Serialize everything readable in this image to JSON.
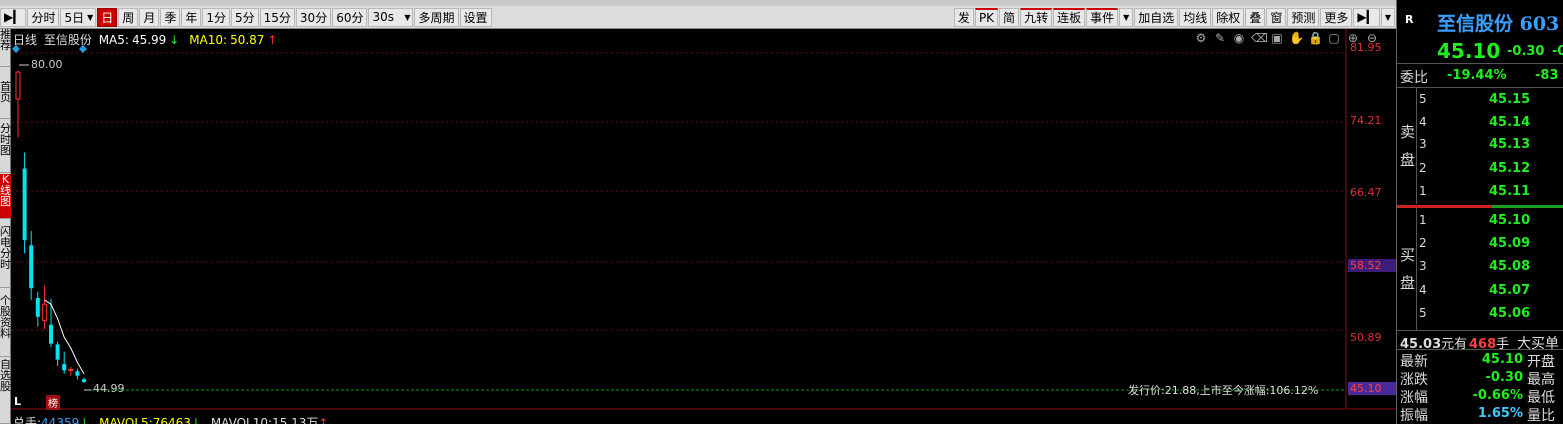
{
  "toolbar": {
    "items": [
      "分时",
      "5日",
      "日",
      "周",
      "月",
      "季",
      "年",
      "1分",
      "5分",
      "15分",
      "30分",
      "60分",
      "30s",
      "多周期",
      "设置"
    ],
    "active": "日",
    "right_items": [
      "发",
      "PK",
      "简",
      "九转",
      "连板",
      "事件",
      "加自选",
      "均线",
      "除权",
      "叠",
      "窗",
      "预测",
      "更多"
    ]
  },
  "left_tabs": [
    "推荐",
    "首页",
    "分时图",
    "K线图",
    "闪电分时",
    "个股资料",
    "自选股"
  ],
  "chart": {
    "period_label": "日线",
    "stock_name": "至信股份",
    "ma5_label": "MA5:",
    "ma5_value": "45.99",
    "ma10_label": "MA10:",
    "ma10_value": "50.87",
    "price_axis": [
      "81.95",
      "74.21",
      "66.47",
      "58.52",
      "50.89",
      "45.10"
    ],
    "high_annotation": "80.00",
    "low_annotation": "44.99",
    "issue_note": "发行价:21.88,上市至今涨幅:106.12%",
    "mark_l": "L",
    "mark_bang": "榜",
    "colors": {
      "up": "#ff3030",
      "down": "#00e5ee",
      "ma5": "#ffffff",
      "ma10": "#ffff00",
      "grid": "#6a0a0a"
    }
  },
  "chart_data": {
    "type": "candlestick",
    "title": "日线 至信股份",
    "ylim": [
      44.2,
      82.5
    ],
    "candles": [
      {
        "open": 76.8,
        "close": 79.8,
        "high": 80.0,
        "low": 72.5
      },
      {
        "open": 69.0,
        "close": 61.0,
        "high": 70.8,
        "low": 59.5
      },
      {
        "open": 60.4,
        "close": 55.6,
        "high": 62.0,
        "low": 54.3
      },
      {
        "open": 54.5,
        "close": 52.4,
        "high": 55.2,
        "low": 51.3
      },
      {
        "open": 52.0,
        "close": 53.8,
        "high": 55.9,
        "low": 51.0
      },
      {
        "open": 51.5,
        "close": 49.4,
        "high": 54.4,
        "low": 49.0
      },
      {
        "open": 49.3,
        "close": 47.6,
        "high": 49.6,
        "low": 46.9
      },
      {
        "open": 47.1,
        "close": 46.4,
        "high": 48.5,
        "low": 46.0
      },
      {
        "open": 46.4,
        "close": 46.5,
        "high": 46.8,
        "low": 45.8
      },
      {
        "open": 46.3,
        "close": 45.8,
        "high": 46.6,
        "low": 45.4
      },
      {
        "open": 45.4,
        "close": 45.1,
        "high": 45.6,
        "low": 44.99
      }
    ],
    "ma5": [
      null,
      null,
      null,
      null,
      54.3,
      53.8,
      52.2,
      50.1,
      48.9,
      47.3,
      46.0
    ]
  },
  "volume": {
    "total_label": "总手:",
    "total_value": "44359",
    "ma5_label": "MAVOL5:",
    "ma5_value": "76463",
    "ma10_label": "MAVOL10:",
    "ma10_value": "15.13万"
  },
  "quote": {
    "badge": "R",
    "name": "至信股份 603",
    "price": "45.10",
    "change": "-0.30",
    "pct": "-0",
    "weibi_label": "委比",
    "weibi": "-19.44%",
    "weicha": "-83",
    "sell_label_1": "卖",
    "sell_label_2": "盘",
    "buy_label_1": "买",
    "buy_label_2": "盘",
    "sell": [
      {
        "n": "5",
        "p": "45.15"
      },
      {
        "n": "4",
        "p": "45.14"
      },
      {
        "n": "3",
        "p": "45.13"
      },
      {
        "n": "2",
        "p": "45.12"
      },
      {
        "n": "1",
        "p": "45.11"
      }
    ],
    "buy": [
      {
        "n": "1",
        "p": "45.10"
      },
      {
        "n": "2",
        "p": "45.09"
      },
      {
        "n": "3",
        "p": "45.08"
      },
      {
        "n": "4",
        "p": "45.07"
      },
      {
        "n": "5",
        "p": "45.06"
      }
    ],
    "big_amount": "45.03",
    "big_unit": "元有",
    "big_vol": "468",
    "big_vol_unit": "手",
    "big_label": "大买单",
    "stats": [
      {
        "k": "最新",
        "v": "45.10",
        "k2": "开盘",
        "c": "#20ee20"
      },
      {
        "k": "涨跌",
        "v": "-0.30",
        "k2": "最高",
        "c": "#20ee20"
      },
      {
        "k": "涨幅",
        "v": "-0.66%",
        "k2": "最低",
        "c": "#20ee20"
      },
      {
        "k": "振幅",
        "v": "1.65%",
        "k2": "量比",
        "c": "#40c8ff"
      }
    ]
  }
}
